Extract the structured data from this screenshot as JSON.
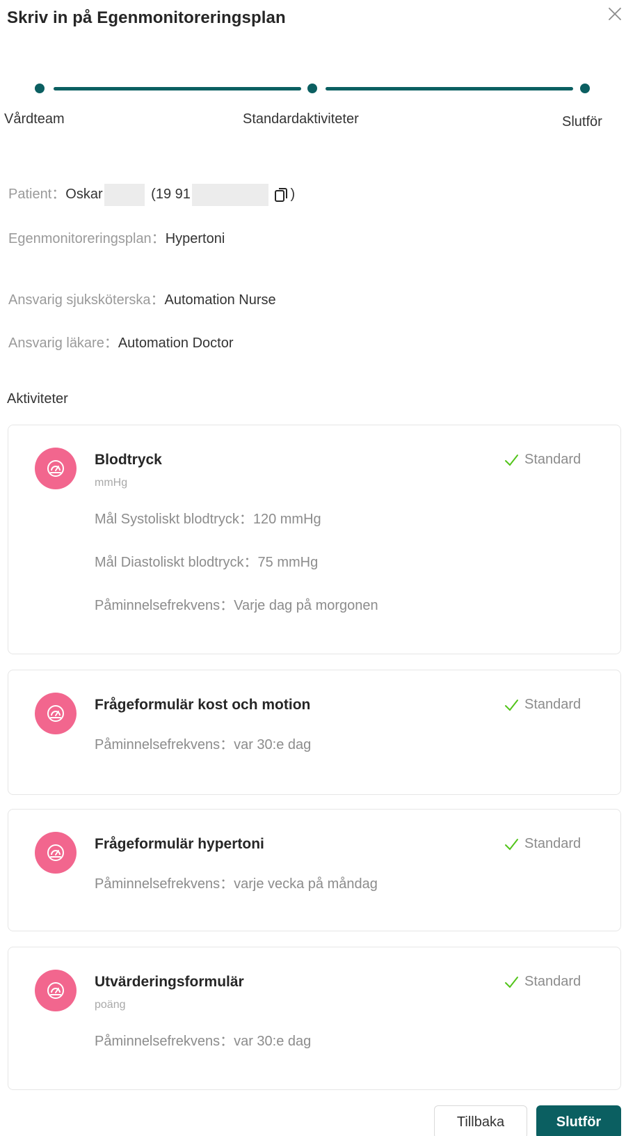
{
  "dialog": {
    "title": "Skriv in på Egenmonitoreringsplan"
  },
  "stepper": {
    "steps": [
      {
        "label": "Vårdteam"
      },
      {
        "label": "Standardaktiviteter"
      },
      {
        "label": "Slutför"
      }
    ]
  },
  "info": {
    "patient_label": "Patient：",
    "patient_name": "Oskar",
    "patient_id_prefix": "(19 91",
    "patient_id_suffix": ")",
    "plan_label": "Egenmonitoreringsplan：",
    "plan_value": "Hypertoni",
    "nurse_label": "Ansvarig sjuksköterska：",
    "nurse_value": "Automation Nurse",
    "doctor_label": "Ansvarig läkare：",
    "doctor_value": "Automation Doctor"
  },
  "activities_title": "Aktiviteter",
  "activities": [
    {
      "name": "Blodtryck",
      "unit": "mmHg",
      "badge": "Standard",
      "icon": "gauge-icon",
      "lines": [
        {
          "label": "Mål Systoliskt blodtryck：",
          "value": "120 mmHg"
        },
        {
          "label": "Mål Diastoliskt blodtryck：",
          "value": "75 mmHg"
        },
        {
          "label": "Påminnelsefrekvens：",
          "value": "Varje dag på morgonen"
        }
      ]
    },
    {
      "name": "Frågeformulär kost och motion",
      "badge": "Standard",
      "icon": "gauge-icon",
      "lines": [
        {
          "label": "Påminnelsefrekvens：",
          "value": "var 30:e dag"
        }
      ]
    },
    {
      "name": "Frågeformulär hypertoni",
      "badge": "Standard",
      "icon": "gauge-icon",
      "lines": [
        {
          "label": "Påminnelsefrekvens：",
          "value": "varje vecka på måndag"
        }
      ]
    },
    {
      "name": "Utvärderingsformulär",
      "unit": "poäng",
      "badge": "Standard",
      "icon": "gauge-icon",
      "lines": [
        {
          "label": "Påminnelsefrekvens：",
          "value": "var 30:e dag"
        }
      ]
    }
  ],
  "footer": {
    "back_label": "Tillbaka",
    "finish_label": "Slutför"
  },
  "colors": {
    "primary": "#0b5f61",
    "activity_icon_bg": "#f2668e",
    "check": "#52c41a"
  }
}
